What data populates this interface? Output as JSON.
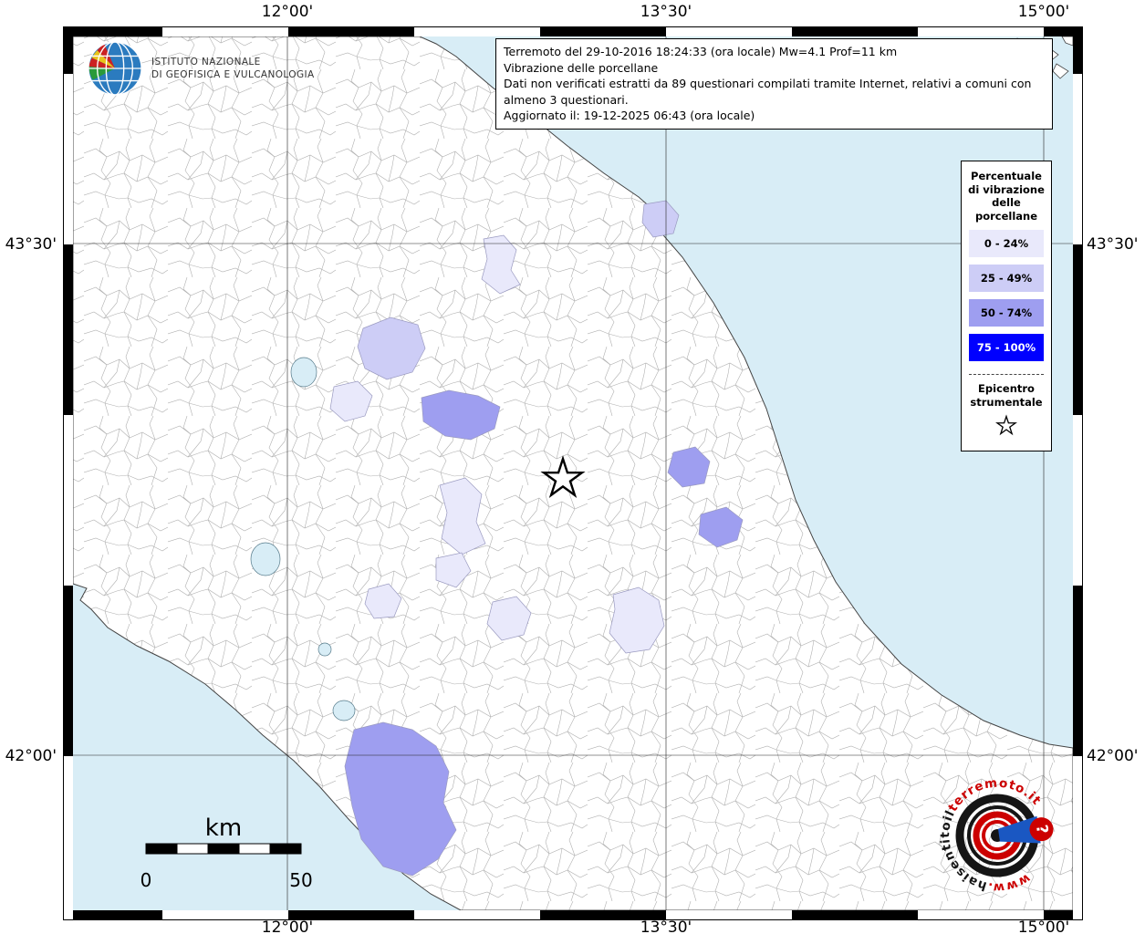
{
  "brand": {
    "name_line1": "ISTITUTO NAZIONALE",
    "name_line2": "DI GEOFISICA E VULCANOLOGIA"
  },
  "infobox": {
    "line1": "Terremoto del 29-10-2016 18:24:33 (ora locale) Mw=4.1 Prof=11 km",
    "line2": "Vibrazione delle porcellane",
    "line3": "Dati non verificati estratti da 89 questionari compilati tramite Internet, relativi a comuni con almeno 3 questionari.",
    "line4": "Aggiornato il: 19-12-2025 06:43 (ora locale)"
  },
  "legend": {
    "title_line1": "Percentuale",
    "title_line2": "di vibrazione",
    "title_line3": "delle",
    "title_line4": "porcellane",
    "items": [
      {
        "label": "0 - 24%",
        "color": "#e9e9fb",
        "text_color": "#000000"
      },
      {
        "label": "25 - 49%",
        "color": "#cdcdf6",
        "text_color": "#000000"
      },
      {
        "label": "50 - 74%",
        "color": "#9e9ef0",
        "text_color": "#000000"
      },
      {
        "label": "75 - 100%",
        "color": "#0000ff",
        "text_color": "#ffffff"
      }
    ],
    "epicenter_line1": "Epicentro",
    "epicenter_line2": "strumentale"
  },
  "axis": {
    "top_labels": [
      "12°00'",
      "13°30'",
      "15°00'"
    ],
    "bottom_labels": [
      "12°00'",
      "13°30'",
      "15°00'"
    ],
    "left_labels": [
      "43°30'",
      "42°00'"
    ],
    "right_labels": [
      "43°30'",
      "42°00'"
    ]
  },
  "map": {
    "sea_color": "#d8edf6",
    "land_color": "#ffffff",
    "boundary_color": "#b0b0b0",
    "coast_color": "#444444"
  },
  "scalebar": {
    "unit": "km",
    "start_label": "0",
    "end_label": "50"
  },
  "watermark": {
    "prefix": "www.",
    "middle": "haisentito",
    "connector": "il",
    "site": "terremoto.it",
    "question_mark": "?",
    "red": "#cc0000",
    "blue": "#1a57c2",
    "black": "#151515"
  }
}
